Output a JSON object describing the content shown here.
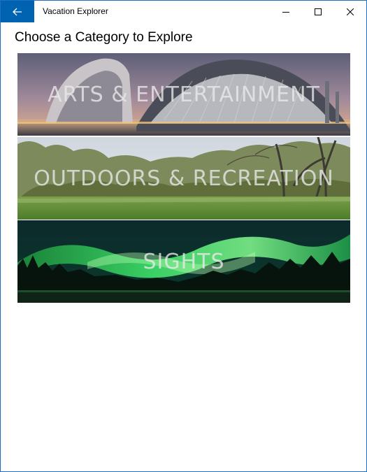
{
  "window": {
    "title": "Vacation Explorer",
    "accent_color": "#0063b1",
    "back_icon": "arrow-left-icon",
    "minimize_icon": "minimize-icon",
    "maximize_icon": "maximize-icon",
    "close_icon": "close-icon"
  },
  "page": {
    "heading": "Choose a Category to Explore"
  },
  "categories": [
    {
      "label": "ARTS & ENTERTAINMENT",
      "image": "city-of-arts-and-sciences-photo"
    },
    {
      "label": "OUTDOORS & RECREATION",
      "image": "park-trees-meadow-photo"
    },
    {
      "label": "SIGHTS",
      "image": "aurora-borealis-photo"
    }
  ]
}
